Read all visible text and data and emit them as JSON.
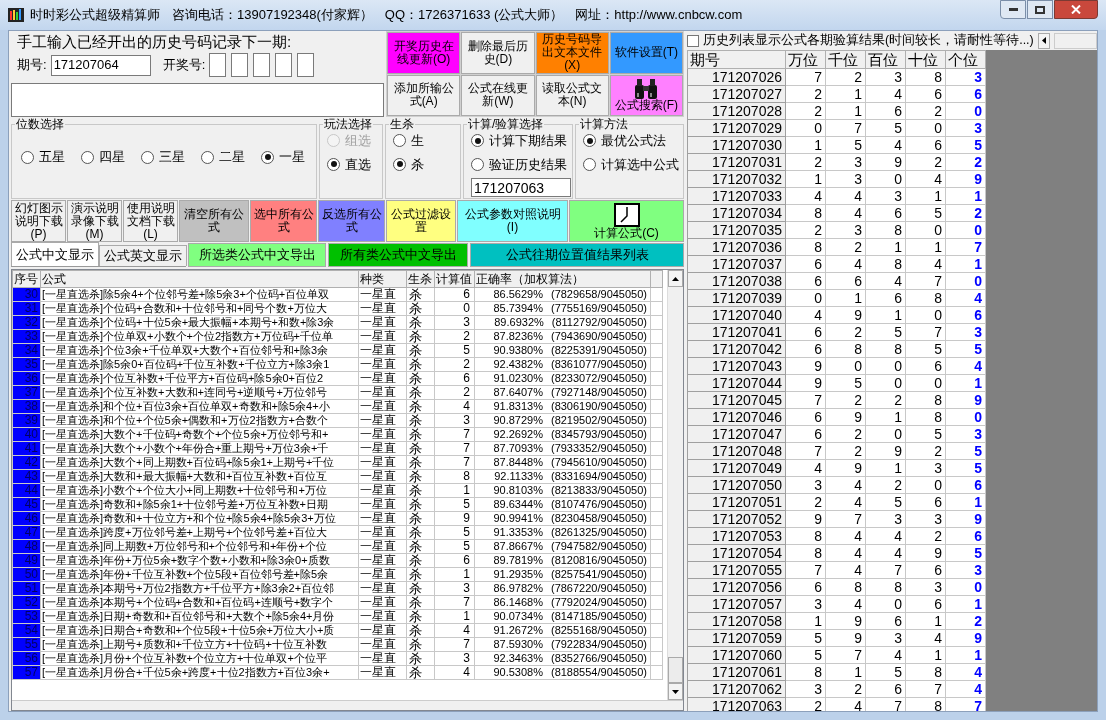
{
  "window": {
    "title": "时时彩公式超级精算师",
    "phone": "咨询电话：13907192348(付家辉）",
    "qq": "QQ：1726371633 (公式大师）",
    "site": "网址：http://www.cnbcw.com"
  },
  "entry": {
    "heading": "手工输入已经开出的历史号码记录下一期:",
    "period_label": "期号:",
    "period_value": "171207064",
    "draw_label": "开奖号:"
  },
  "top_buttons": [
    {
      "label": "开奖历史在线更新(O)",
      "color": "#ff00ff",
      "kind": "text"
    },
    {
      "label": "删除最后历史(D)",
      "color": "#f0f0f0",
      "kind": "text"
    },
    {
      "label": "历史号码导出文本文件(X)",
      "color": "#ff8000",
      "kind": "text"
    },
    {
      "label": "软件设置(T)",
      "color": "#3399ff",
      "kind": "text"
    },
    {
      "label": "添加所输公式(A)",
      "color": "#f0f0f0",
      "kind": "text"
    },
    {
      "label": "公式在线更新(W)",
      "color": "#f0f0f0",
      "kind": "text"
    },
    {
      "label": "读取公式文本(N)",
      "color": "#f0f0f0",
      "kind": "text"
    },
    {
      "label": "公式搜索(F)",
      "color": "#ff80ff",
      "kind": "binoculars"
    }
  ],
  "groups": [
    {
      "title": "位数选择",
      "kind": "row",
      "options": [
        {
          "label": "五星",
          "selected": false,
          "disabled": false
        },
        {
          "label": "四星",
          "selected": false,
          "disabled": false
        },
        {
          "label": "三星",
          "selected": false,
          "disabled": false
        },
        {
          "label": "二星",
          "selected": false,
          "disabled": false
        },
        {
          "label": "一星",
          "selected": true,
          "disabled": false
        }
      ]
    },
    {
      "title": "玩法选择",
      "kind": "column",
      "options": [
        {
          "label": "组选",
          "selected": false,
          "disabled": true
        },
        {
          "label": "直选",
          "selected": true,
          "disabled": false
        }
      ]
    },
    {
      "title": "生杀",
      "kind": "column",
      "options": [
        {
          "label": "生",
          "selected": false,
          "disabled": false
        },
        {
          "label": "杀",
          "selected": true,
          "disabled": false
        }
      ]
    },
    {
      "title": "计算/验算选择",
      "kind": "column",
      "options": [
        {
          "label": "计算下期结果",
          "selected": true,
          "disabled": false
        },
        {
          "label": "验证历史结果",
          "selected": false,
          "disabled": false
        }
      ],
      "field_value": "171207063"
    },
    {
      "title": "计算方法",
      "kind": "column",
      "options": [
        {
          "label": "最优公式法",
          "selected": true,
          "disabled": false
        },
        {
          "label": "计算选中公式",
          "selected": false,
          "disabled": false
        }
      ]
    }
  ],
  "action_buttons": [
    {
      "label": "幻灯图示说明下载(P)",
      "color": "#f0f0f0",
      "kind": "text"
    },
    {
      "label": "演示说明录像下载(M)",
      "color": "#f0f0f0",
      "kind": "text"
    },
    {
      "label": "使用说明文档下载(L)",
      "color": "#f0f0f0",
      "kind": "text"
    },
    {
      "label": "清空所有公式",
      "color": "#c0c0c0",
      "kind": "text"
    },
    {
      "label": "选中所有公式",
      "color": "#ff8080",
      "kind": "text"
    },
    {
      "label": "反选所有公式",
      "color": "#8080ff",
      "kind": "text"
    },
    {
      "label": "公式过滤设置",
      "color": "#ffff80",
      "kind": "text"
    },
    {
      "label": "公式参数对照说明(I)",
      "color": "#80ffff",
      "kind": "text"
    },
    {
      "label": "计算公式(C)",
      "color": "#80ff80",
      "kind": "clock"
    }
  ],
  "view_tabs": [
    {
      "label": "公式中文显示",
      "selected": true
    },
    {
      "label": "公式英文显示",
      "selected": false
    }
  ],
  "export_buttons": [
    {
      "label": "所选类公式中文导出",
      "color": "#80ff80"
    },
    {
      "label": "所有类公式中文导出",
      "color": "#00c000"
    },
    {
      "label": "公式往期位置值结果列表",
      "color": "#00c0c0"
    }
  ],
  "formula_table": {
    "columns": [
      "序号",
      "公式",
      "种类",
      "生杀",
      "计算值",
      "正确率（加权算法）"
    ],
    "rows": [
      {
        "no": "30",
        "formula": "[一星直选杀]除5余4+个位邻号差+除5余3+个位码+百位单双",
        "type": "一星直",
        "mode": "杀",
        "value": "6",
        "accuracy": "86.5629%",
        "ratio": "(7829658/9045050)",
        "selected": true
      },
      {
        "no": "31",
        "formula": "[一星直选杀]个位码+合数和+十位邻号和+同号个数+万位大",
        "type": "一星直",
        "mode": "杀",
        "value": "0",
        "accuracy": "85.7394%",
        "ratio": "(7755169/9045050)",
        "selected": true
      },
      {
        "no": "32",
        "formula": "[一星直选杀]个位码+十位5余+最大振幅+本期号+和数+除3余",
        "type": "一星直",
        "mode": "杀",
        "value": "3",
        "accuracy": "89.6932%",
        "ratio": "(8112792/9045050)",
        "selected": true
      },
      {
        "no": "33",
        "formula": "[一星直选杀]个位单双+小数个+个位2指数方+万位码+千位单",
        "type": "一星直",
        "mode": "杀",
        "value": "2",
        "accuracy": "87.8236%",
        "ratio": "(7943690/9045050)",
        "selected": true
      },
      {
        "no": "34",
        "formula": "[一星直选杀]个位3余+千位单双+大数个+百位邻号和+除3余",
        "type": "一星直",
        "mode": "杀",
        "value": "5",
        "accuracy": "90.9380%",
        "ratio": "(8225391/9045050)",
        "selected": true
      },
      {
        "no": "35",
        "formula": "[一星直选杀]除5余0+百位码+千位互补数+千位立方+除3余1",
        "type": "一星直",
        "mode": "杀",
        "value": "2",
        "accuracy": "92.4382%",
        "ratio": "(8361077/9045050)",
        "selected": true
      },
      {
        "no": "36",
        "formula": "[一星直选杀]个位互补数+千位平方+百位码+除5余0+百位2",
        "type": "一星直",
        "mode": "杀",
        "value": "6",
        "accuracy": "91.0230%",
        "ratio": "(8233072/9045050)",
        "selected": true
      },
      {
        "no": "37",
        "formula": "[一星直选杀]个位互补数+大数和+连同号+逆顺号+万位邻号",
        "type": "一星直",
        "mode": "杀",
        "value": "2",
        "accuracy": "87.6407%",
        "ratio": "(7927148/9045050)",
        "selected": true
      },
      {
        "no": "38",
        "formula": "[一星直选杀]和个位+百位3余+百位单双+奇数和+除5余4+小",
        "type": "一星直",
        "mode": "杀",
        "value": "4",
        "accuracy": "91.8313%",
        "ratio": "(8306190/9045050)",
        "selected": true
      },
      {
        "no": "39",
        "formula": "[一星直选杀]和个位+个位5余+偶数和+万位2指数方+合数个",
        "type": "一星直",
        "mode": "杀",
        "value": "3",
        "accuracy": "90.8729%",
        "ratio": "(8219502/9045050)",
        "selected": true
      },
      {
        "no": "40",
        "formula": "[一星直选杀]大数个+千位码+奇数个+个位5余+万位邻号和+",
        "type": "一星直",
        "mode": "杀",
        "value": "7",
        "accuracy": "92.2692%",
        "ratio": "(8345793/9045050)",
        "selected": true
      },
      {
        "no": "41",
        "formula": "[一星直选杀]大数个+小数个+年份合+重上期号+万位3余+千",
        "type": "一星直",
        "mode": "杀",
        "value": "7",
        "accuracy": "87.7093%",
        "ratio": "(7933352/9045050)",
        "selected": true
      },
      {
        "no": "42",
        "formula": "[一星直选杀]大数个+同上期数+百位码+除5余1+上期号+千位",
        "type": "一星直",
        "mode": "杀",
        "value": "7",
        "accuracy": "87.8448%",
        "ratio": "(7945610/9045050)",
        "selected": true
      },
      {
        "no": "43",
        "formula": "[一星直选杀]大数和+最大振幅+大数和+百位互补数+百位互",
        "type": "一星直",
        "mode": "杀",
        "value": "8",
        "accuracy": "92.1133%",
        "ratio": "(8331694/9045050)",
        "selected": true
      },
      {
        "no": "44",
        "formula": "[一星直选杀]小数个+个位大小+同上期数+十位邻号和+万位",
        "type": "一星直",
        "mode": "杀",
        "value": "1",
        "accuracy": "90.8103%",
        "ratio": "(8213833/9045050)",
        "selected": true
      },
      {
        "no": "45",
        "formula": "[一星直选杀]奇数和+除5余1+十位邻号差+万位互补数+日期",
        "type": "一星直",
        "mode": "杀",
        "value": "5",
        "accuracy": "89.6344%",
        "ratio": "(8107476/9045050)",
        "selected": true
      },
      {
        "no": "46",
        "formula": "[一星直选杀]奇数和+十位立方+和个位+除5余4+除5余3+万位",
        "type": "一星直",
        "mode": "杀",
        "value": "9",
        "accuracy": "90.9941%",
        "ratio": "(8230458/9045050)",
        "selected": true
      },
      {
        "no": "47",
        "formula": "[一星直选杀]跨度+万位邻号差+上期号+个位邻号差+百位大",
        "type": "一星直",
        "mode": "杀",
        "value": "5",
        "accuracy": "91.3353%",
        "ratio": "(8261325/9045050)",
        "selected": true
      },
      {
        "no": "48",
        "formula": "[一星直选杀]同上期数+万位邻号和+个位邻号和+年份+个位",
        "type": "一星直",
        "mode": "杀",
        "value": "5",
        "accuracy": "87.8667%",
        "ratio": "(7947582/9045050)",
        "selected": true
      },
      {
        "no": "49",
        "formula": "[一星直选杀]年份+万位5余+数字个数+小数和+除3余0+质数",
        "type": "一星直",
        "mode": "杀",
        "value": "6",
        "accuracy": "89.7819%",
        "ratio": "(8120816/9045050)",
        "selected": true
      },
      {
        "no": "50",
        "formula": "[一星直选杀]年份+千位互补数+个位5段+百位邻号差+除5余",
        "type": "一星直",
        "mode": "杀",
        "value": "1",
        "accuracy": "91.2935%",
        "ratio": "(8257541/9045050)",
        "selected": true
      },
      {
        "no": "51",
        "formula": "[一星直选杀]本期号+万位2指数方+千位平方+除3余2+百位邻",
        "type": "一星直",
        "mode": "杀",
        "value": "3",
        "accuracy": "86.9782%",
        "ratio": "(7867220/9045050)",
        "selected": true
      },
      {
        "no": "52",
        "formula": "[一星直选杀]本期号+个位码+合数和+百位码+连顺号+数字个",
        "type": "一星直",
        "mode": "杀",
        "value": "7",
        "accuracy": "86.1468%",
        "ratio": "(7792024/9045050)",
        "selected": true
      },
      {
        "no": "53",
        "formula": "[一星直选杀]日期+奇数和+百位邻号和+大数个+除5余4+月份",
        "type": "一星直",
        "mode": "杀",
        "value": "1",
        "accuracy": "90.0734%",
        "ratio": "(8147185/9045050)",
        "selected": true
      },
      {
        "no": "54",
        "formula": "[一星直选杀]日期合+奇数和+个位5段+十位5余+万位大小+质",
        "type": "一星直",
        "mode": "杀",
        "value": "4",
        "accuracy": "91.2672%",
        "ratio": "(8255168/9045050)",
        "selected": true
      },
      {
        "no": "55",
        "formula": "[一星直选杀]上期号+质数和+千位立方+十位码+十位互补数",
        "type": "一星直",
        "mode": "杀",
        "value": "7",
        "accuracy": "87.5930%",
        "ratio": "(7922834/9045050)",
        "selected": true
      },
      {
        "no": "56",
        "formula": "[一星直选杀]月份+个位互补数+个位立方+十位单双+个位平",
        "type": "一星直",
        "mode": "杀",
        "value": "3",
        "accuracy": "92.3463%",
        "ratio": "(8352766/9045050)",
        "selected": true
      },
      {
        "no": "57",
        "formula": "[一星直选杀]月份合+千位5余+跨度+十位2指数方+百位3余+",
        "type": "一星直",
        "mode": "杀",
        "value": "4",
        "accuracy": "90.5308%",
        "ratio": "(8188554/9045050)",
        "selected": true
      }
    ]
  },
  "history": {
    "option": {
      "label": "历史列表显示公式各期验算结果(时间较长，请耐性等待...)",
      "checked": false
    },
    "columns": [
      "期号",
      "万位",
      "千位",
      "百位",
      "十位",
      "个位"
    ],
    "rows": [
      [
        "171207026",
        "7",
        "2",
        "3",
        "8",
        "3"
      ],
      [
        "171207027",
        "2",
        "1",
        "4",
        "6",
        "6"
      ],
      [
        "171207028",
        "2",
        "1",
        "6",
        "2",
        "0"
      ],
      [
        "171207029",
        "0",
        "7",
        "5",
        "0",
        "3"
      ],
      [
        "171207030",
        "1",
        "5",
        "4",
        "6",
        "5"
      ],
      [
        "171207031",
        "2",
        "3",
        "9",
        "2",
        "2"
      ],
      [
        "171207032",
        "1",
        "3",
        "0",
        "4",
        "9"
      ],
      [
        "171207033",
        "4",
        "4",
        "3",
        "1",
        "1"
      ],
      [
        "171207034",
        "8",
        "4",
        "6",
        "5",
        "2"
      ],
      [
        "171207035",
        "2",
        "3",
        "8",
        "0",
        "0"
      ],
      [
        "171207036",
        "8",
        "2",
        "1",
        "1",
        "7"
      ],
      [
        "171207037",
        "6",
        "4",
        "8",
        "4",
        "1"
      ],
      [
        "171207038",
        "6",
        "6",
        "4",
        "7",
        "0"
      ],
      [
        "171207039",
        "0",
        "1",
        "6",
        "8",
        "4"
      ],
      [
        "171207040",
        "4",
        "9",
        "1",
        "0",
        "6"
      ],
      [
        "171207041",
        "6",
        "2",
        "5",
        "7",
        "3"
      ],
      [
        "171207042",
        "6",
        "8",
        "8",
        "5",
        "5"
      ],
      [
        "171207043",
        "9",
        "0",
        "0",
        "6",
        "4"
      ],
      [
        "171207044",
        "9",
        "5",
        "0",
        "0",
        "1"
      ],
      [
        "171207045",
        "7",
        "2",
        "2",
        "8",
        "9"
      ],
      [
        "171207046",
        "6",
        "9",
        "1",
        "8",
        "0"
      ],
      [
        "171207047",
        "6",
        "2",
        "0",
        "5",
        "3"
      ],
      [
        "171207048",
        "7",
        "2",
        "9",
        "2",
        "5"
      ],
      [
        "171207049",
        "4",
        "9",
        "1",
        "3",
        "5"
      ],
      [
        "171207050",
        "3",
        "4",
        "2",
        "0",
        "6"
      ],
      [
        "171207051",
        "2",
        "4",
        "5",
        "6",
        "1"
      ],
      [
        "171207052",
        "9",
        "7",
        "3",
        "3",
        "9"
      ],
      [
        "171207053",
        "8",
        "4",
        "4",
        "2",
        "6"
      ],
      [
        "171207054",
        "8",
        "4",
        "4",
        "9",
        "5"
      ],
      [
        "171207055",
        "7",
        "4",
        "7",
        "6",
        "3"
      ],
      [
        "171207056",
        "6",
        "8",
        "8",
        "3",
        "0"
      ],
      [
        "171207057",
        "3",
        "4",
        "0",
        "6",
        "1"
      ],
      [
        "171207058",
        "1",
        "9",
        "6",
        "1",
        "2"
      ],
      [
        "171207059",
        "5",
        "9",
        "3",
        "4",
        "9"
      ],
      [
        "171207060",
        "5",
        "7",
        "4",
        "1",
        "1"
      ],
      [
        "171207061",
        "8",
        "1",
        "5",
        "8",
        "4"
      ],
      [
        "171207062",
        "3",
        "2",
        "6",
        "7",
        "4"
      ],
      [
        "171207063",
        "2",
        "4",
        "7",
        "8",
        "7"
      ]
    ]
  }
}
